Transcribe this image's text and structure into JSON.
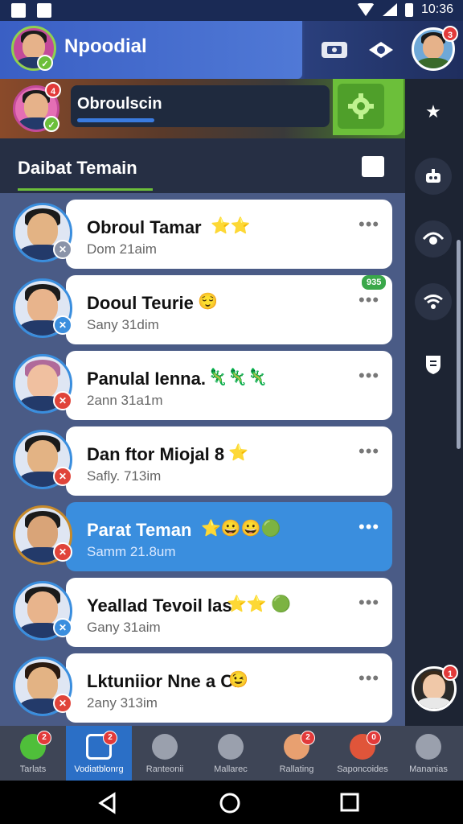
{
  "status_bar": {
    "time": "10:36"
  },
  "app_bar": {
    "title": "Npoodial",
    "profile_badge": "3"
  },
  "profile": {
    "status_text": "Obroulscin",
    "badge": "4"
  },
  "section": {
    "title": "Daibat Temain"
  },
  "friends": [
    {
      "name": "Obroul Tamar",
      "sub": "Dom 21aim",
      "emoji": "⭐⭐",
      "badge_color": "#8a93a8",
      "badge_icon": "wrench-icon",
      "active": false,
      "time": ""
    },
    {
      "name": "Dooul Teurie",
      "sub": "Sany 31dim",
      "emoji": "😌",
      "badge_color": "#3a8ede",
      "badge_icon": "plane-icon",
      "active": false,
      "time": "935"
    },
    {
      "name": "Panulal Ienna.",
      "sub": "2ann 31a1m",
      "emoji": "🦎🦎🦎",
      "badge_color": "#e0443a",
      "badge_icon": "x-icon",
      "active": false,
      "time": ""
    },
    {
      "name": "Dan ftor Miojal 8",
      "sub": "Safly. 713im",
      "emoji": "⭐",
      "badge_color": "#e0443a",
      "badge_icon": "x-icon",
      "active": false,
      "time": ""
    },
    {
      "name": "Parat Teman",
      "sub": "Samm 21.8um",
      "emoji": "⭐😀😀🟢",
      "badge_color": "#e0443a",
      "badge_icon": "x-icon",
      "active": true,
      "time": ""
    },
    {
      "name": "Yeallad Tevoil las",
      "sub": "Gany 31aim",
      "emoji": "⭐⭐ 🟢",
      "badge_color": "#3a8ede",
      "badge_icon": "plane-icon",
      "active": false,
      "time": ""
    },
    {
      "name": "Lktuniior Nne a C:",
      "sub": "2any 313im",
      "emoji": "😉",
      "badge_color": "#e0443a",
      "badge_icon": "x-icon",
      "active": false,
      "time": ""
    }
  ],
  "more_label": "•••",
  "rail_badge": "1",
  "bottom_nav": [
    {
      "label": "Tarlats",
      "icon": "home-icon",
      "badge": "2",
      "active": false
    },
    {
      "label": "Vodiatblonrg",
      "icon": "house-icon",
      "badge": "2",
      "active": true
    },
    {
      "label": "Ranteonii",
      "icon": "blocked-icon",
      "badge": "",
      "active": false
    },
    {
      "label": "Mallarec",
      "icon": "box-icon",
      "badge": "",
      "active": false
    },
    {
      "label": "Rallating",
      "icon": "avatar-icon",
      "badge": "2",
      "active": false
    },
    {
      "label": "Saponcoides",
      "icon": "compass-icon",
      "badge": "0",
      "active": false
    },
    {
      "label": "Mananias",
      "icon": "puzzle-icon",
      "badge": "",
      "active": false
    }
  ]
}
